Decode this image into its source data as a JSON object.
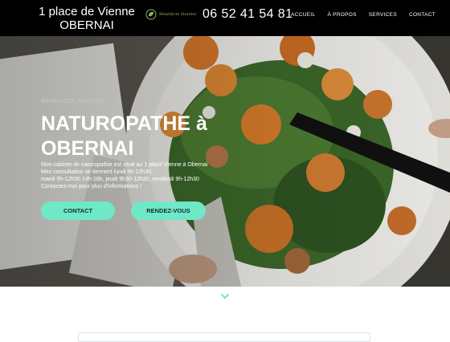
{
  "header": {
    "address_line1": "1 place de Vienne",
    "address_line2": "OBERNAI",
    "logo_text": "Bénédicte Hurstel",
    "phone": "06 52 41 54 81",
    "nav": [
      "ACCUEIL",
      "À PROPOS",
      "SERVICES",
      "CONTACT"
    ]
  },
  "hero": {
    "subtitle": "BÉNÉDICTE HURSTEL",
    "headline_line1": "NATUROPATHE à",
    "headline_line2": "OBERNAI",
    "desc_lines": [
      "Mon cabinet de naturopathie est situé au 1 place Vienne à Obernai",
      "Mes consultation se tiennent lundi 9h-12h30,",
      "mardi 9h-12h30 14h-18h, jeudi 9h30-12h30, vendredi 9h-12h30",
      "Contactez-moi pour plus d'informations !"
    ],
    "buttons": {
      "contact": "CONTACT",
      "rdv": "RENDEZ-VOUS"
    }
  },
  "colors": {
    "accent": "#6fe8c8",
    "topbar": "#000000",
    "logo_green": "#8bb36a"
  },
  "icons": {
    "scroll": "chevron-down-icon",
    "logo": "leaf-logo-icon"
  }
}
